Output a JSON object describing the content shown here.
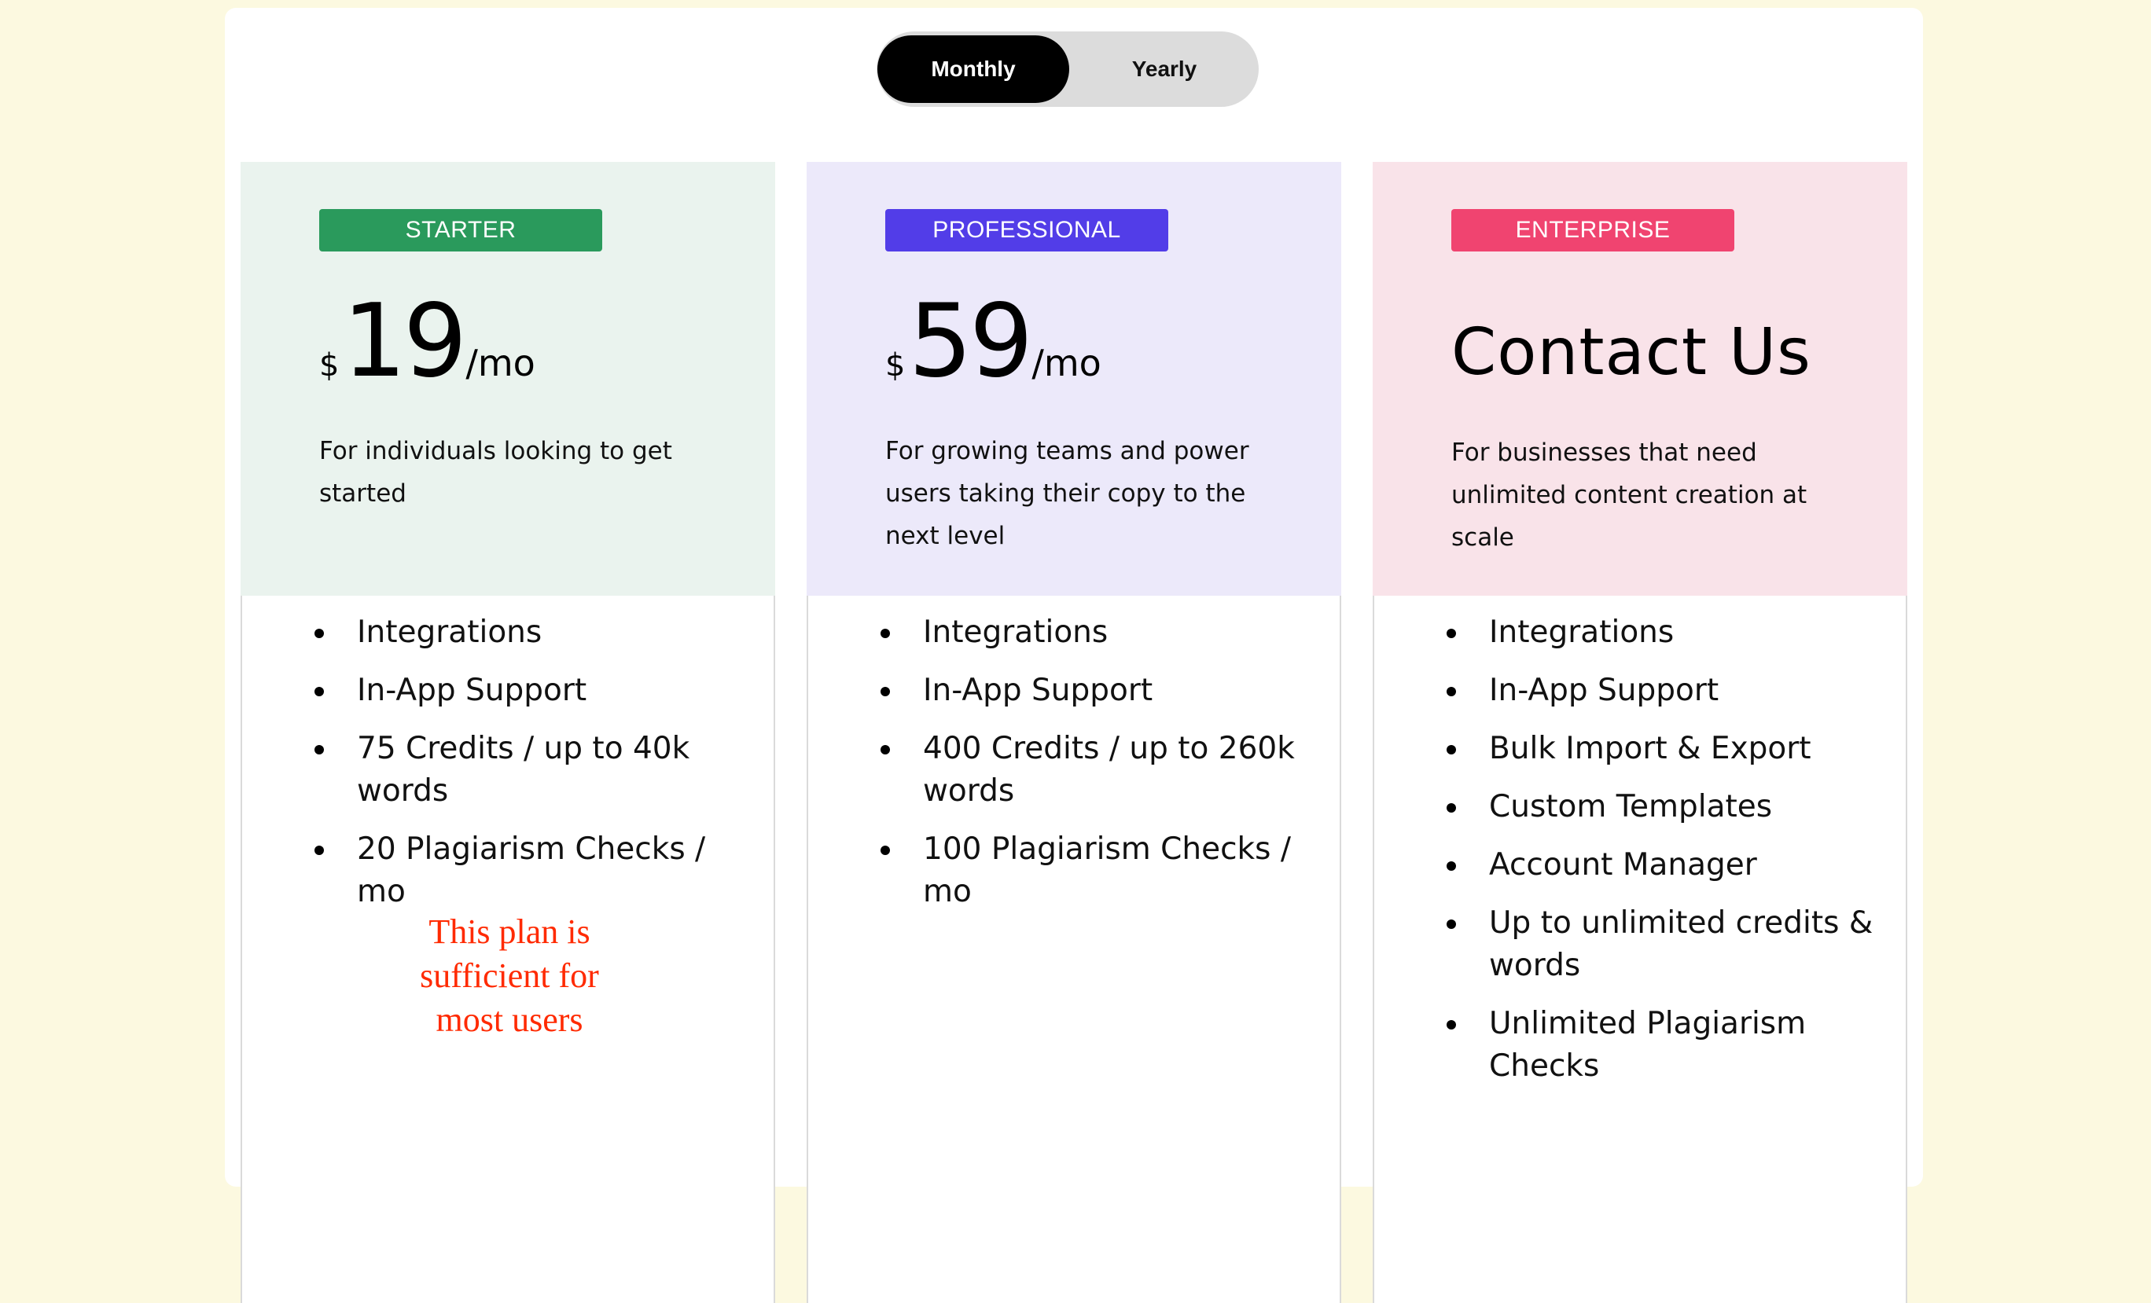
{
  "billing_toggle": {
    "options": [
      "Monthly",
      "Yearly"
    ],
    "selected": "Monthly"
  },
  "colors": {
    "page_background": "#fcf9e0",
    "toggle_active": "#000000",
    "toggle_track": "#dcdcdc"
  },
  "plans": [
    {
      "badge": "STARTER",
      "badge_color": "#2a9a5c",
      "header_bg": "#eaf3ee",
      "currency": "$",
      "amount": "19",
      "period": "/mo",
      "description": "For individuals looking to get started",
      "features": [
        "Integrations",
        "In-App Support",
        "75 Credits / up to 40k words",
        "20 Plagiarism Checks / mo"
      ],
      "note": "This plan is sufficient for most users"
    },
    {
      "badge": "PROFESSIONAL",
      "badge_color": "#523de8",
      "header_bg": "#ece9fa",
      "currency": "$",
      "amount": "59",
      "period": "/mo",
      "description": "For growing teams and power users taking their copy to the next level",
      "features": [
        "Integrations",
        "In-App Support",
        "400 Credits / up to 260k words",
        "100 Plagiarism Checks / mo"
      ]
    },
    {
      "badge": "ENTERPRISE",
      "badge_color": "#f04470",
      "header_bg": "#f9e3e9",
      "price_text": "Contact Us",
      "description": "For businesses that need unlimited content creation at scale",
      "features": [
        "Integrations",
        "In-App Support",
        "Bulk Import & Export",
        "Custom Templates",
        "Account Manager",
        "Up to unlimited credits & words",
        "Unlimited Plagiarism Checks"
      ]
    }
  ]
}
